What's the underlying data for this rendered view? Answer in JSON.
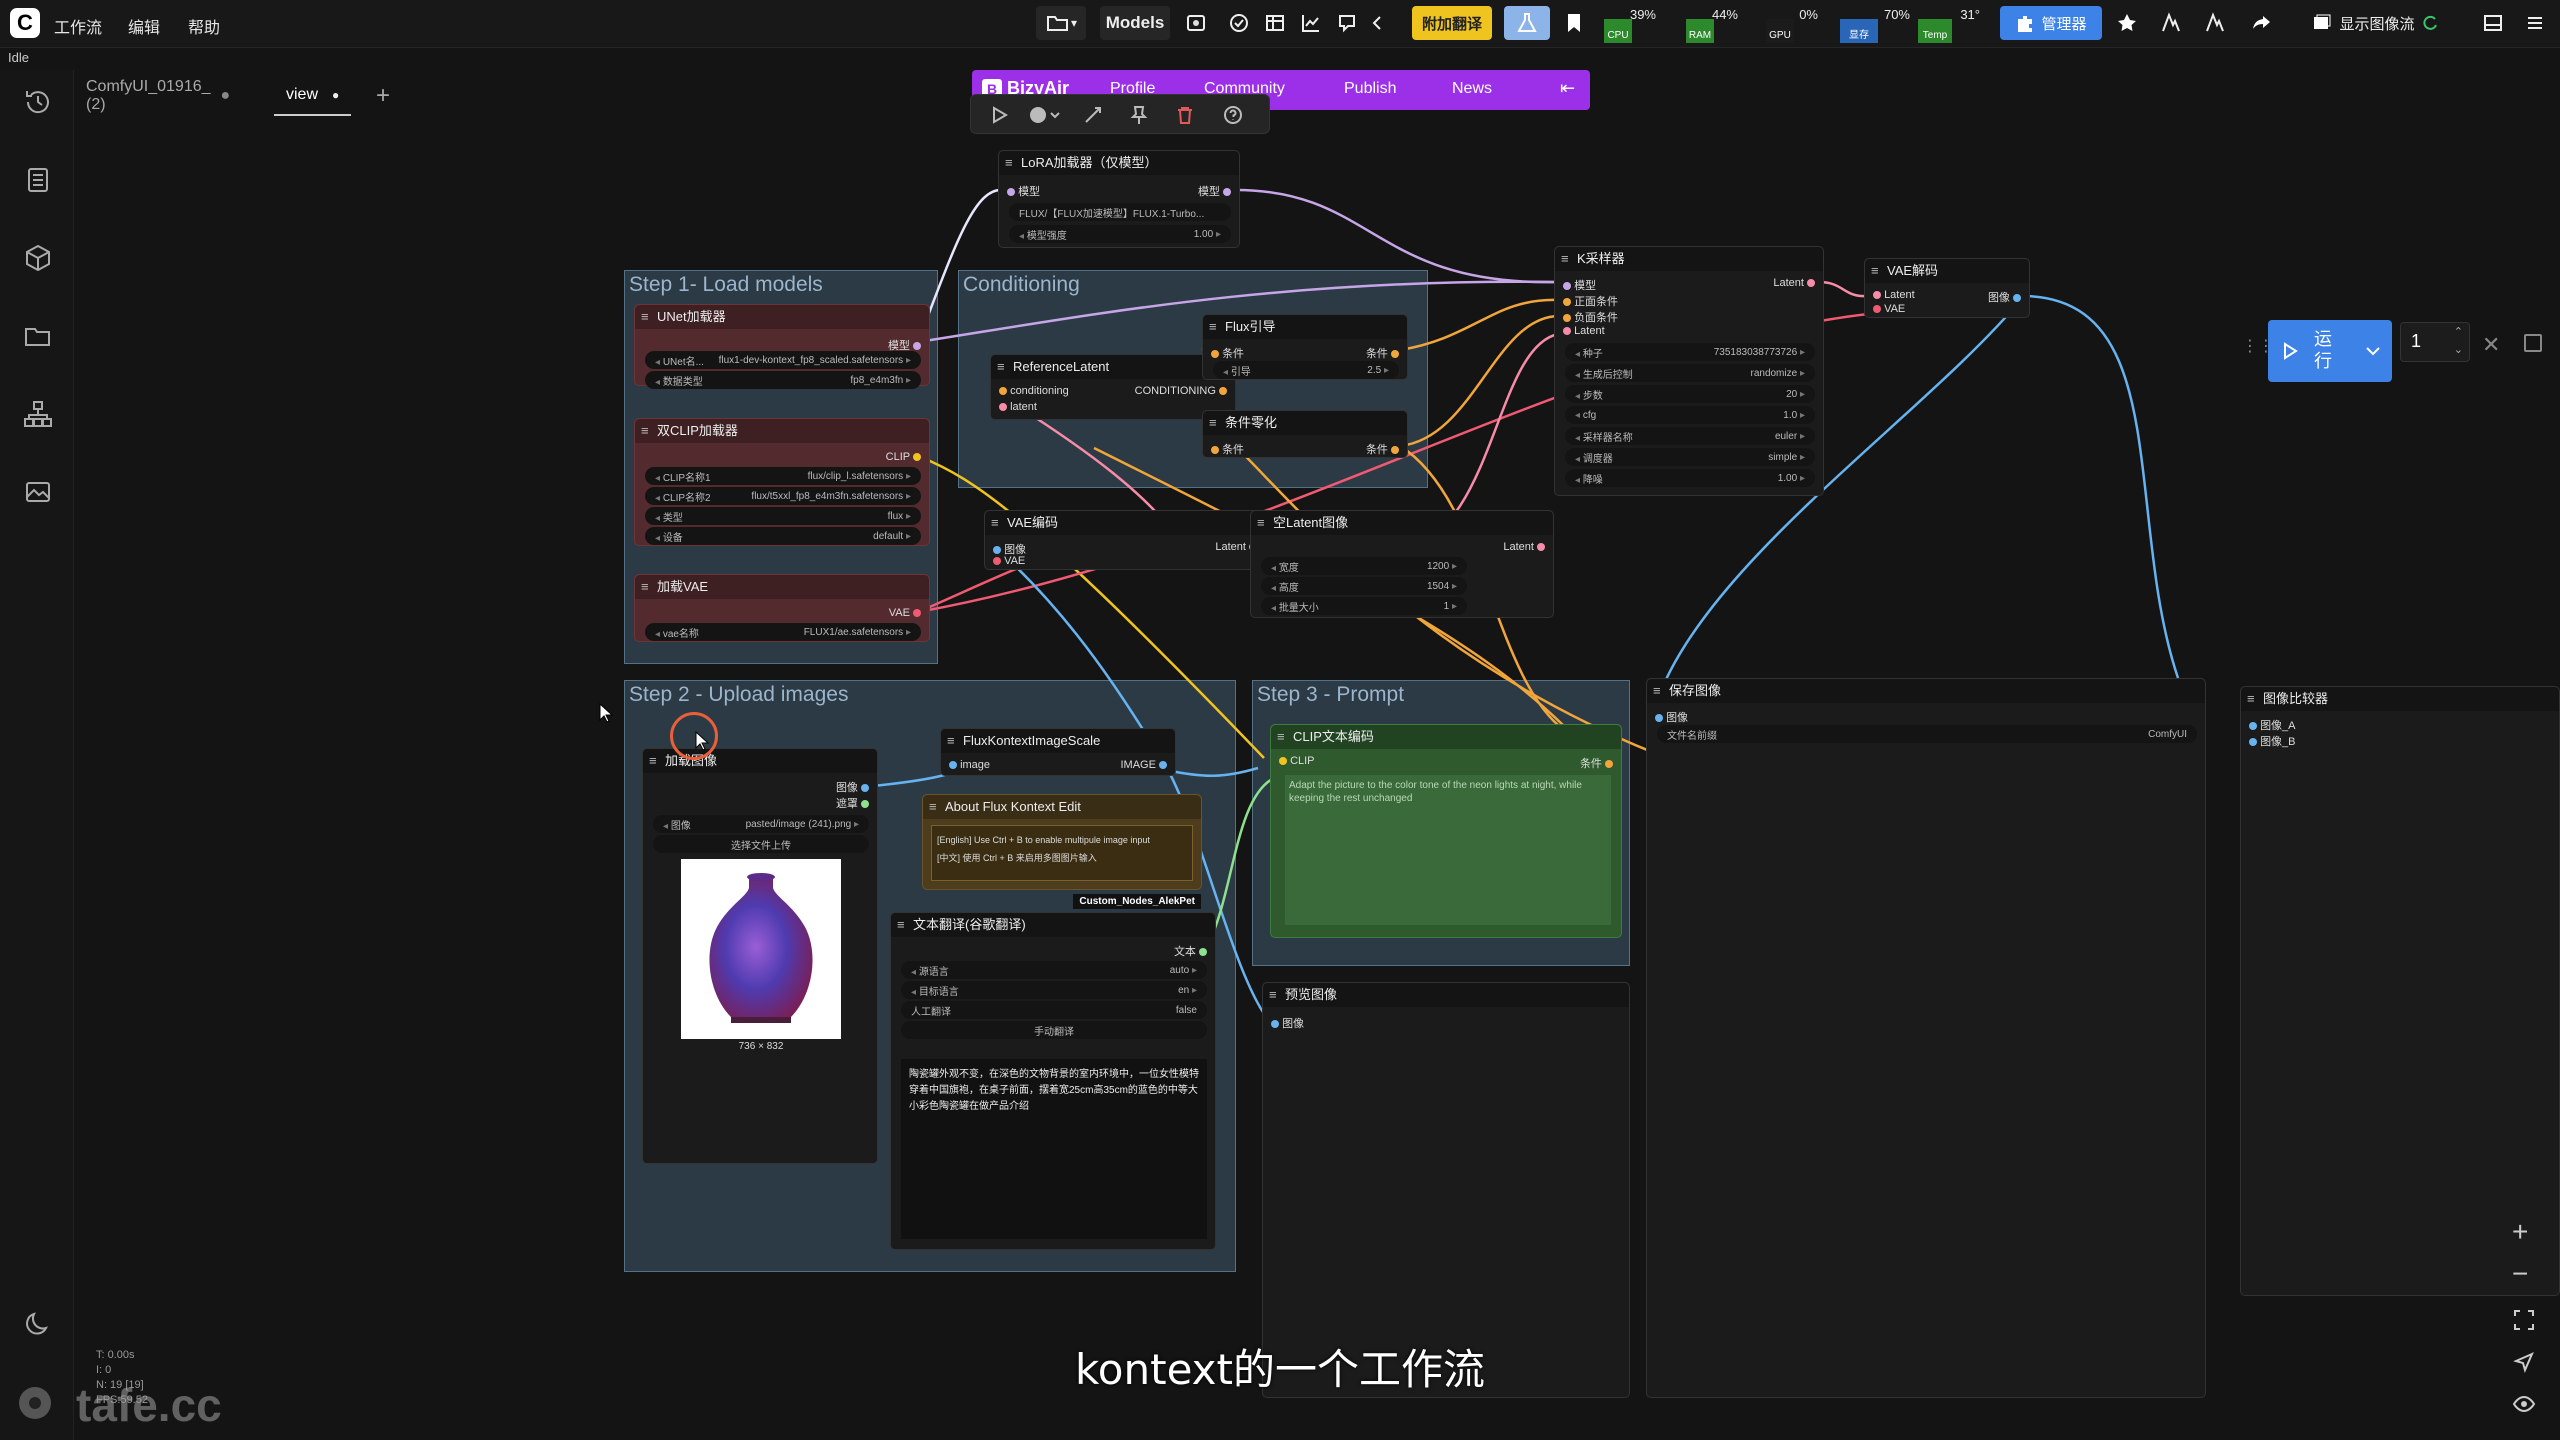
{
  "app": {
    "status": "Idle",
    "menu": [
      "工作流",
      "编辑",
      "帮助"
    ],
    "models_label": "Models",
    "translate_label": "附加翻译",
    "manager_label": "管理器",
    "show_image_flow_label": "显示图像流",
    "logo_letter": "C"
  },
  "resources": [
    {
      "name": "CPU",
      "pct": "39%",
      "color": "#2c8a2c"
    },
    {
      "name": "RAM",
      "pct": "44%",
      "color": "#2c8a2c"
    },
    {
      "name": "GPU",
      "pct": "0%",
      "color": "#1b1b1b"
    },
    {
      "name": "显存",
      "pct": "70%",
      "color": "#2a66b8"
    },
    {
      "name": "Temp",
      "pct": "31°",
      "color": "#2c8a2c"
    }
  ],
  "tabs": [
    {
      "label": "ComfyUI_01916_ (2)"
    },
    {
      "label": "view"
    }
  ],
  "bizyair": {
    "brand": "BizyAir",
    "items": [
      "Profile",
      "Community",
      "Publish",
      "News"
    ]
  },
  "groups": {
    "step1": "Step 1- Load models",
    "conditioning": "Conditioning",
    "step2": "Step 2 - Upload images",
    "step3": "Step 3 - Prompt"
  },
  "nodes": {
    "lora": {
      "title": "LoRA加载器（仅模型）",
      "in": "模型",
      "out": "模型",
      "w1_label": "FLUX/【FLUX加速模型】FLUX.1-Turbo...",
      "w2_label": "模型强度",
      "w2_value": "1.00"
    },
    "unet": {
      "title": "UNet加载器",
      "out": "模型",
      "w1_label": "UNet名...",
      "w1_value": "flux1-dev-kontext_fp8_scaled.safetensors",
      "w2_label": "数据类型",
      "w2_value": "fp8_e4m3fn"
    },
    "clip": {
      "title": "双CLIP加载器",
      "out": "CLIP",
      "w1_label": "CLIP名称1",
      "w1_value": "flux/clip_l.safetensors",
      "w2_label": "CLIP名称2",
      "w2_value": "flux/t5xxl_fp8_e4m3fn.safetensors",
      "w3_label": "类型",
      "w3_value": "flux",
      "w4_label": "设备",
      "w4_value": "default"
    },
    "vae_load": {
      "title": "加载VAE",
      "out": "VAE",
      "w1_label": "vae名称",
      "w1_value": "FLUX1/ae.safetensors"
    },
    "ref_latent": {
      "title": "ReferenceLatent",
      "in1": "conditioning",
      "in2": "latent",
      "out": "CONDITIONING"
    },
    "flux_guide": {
      "title": "Flux引导",
      "in": "条件",
      "out": "条件",
      "w1_label": "引导",
      "w1_value": "2.5"
    },
    "zero_cond": {
      "title": "条件零化",
      "in": "条件",
      "out": "条件"
    },
    "vae_encode": {
      "title": "VAE编码",
      "in1": "图像",
      "in2": "VAE",
      "out": "Latent"
    },
    "empty_latent": {
      "title": "空Latent图像",
      "out": "Latent",
      "w1_label": "宽度",
      "w1_value": "1200",
      "w2_label": "高度",
      "w2_value": "1504",
      "w3_label": "批量大小",
      "w3_value": "1"
    },
    "ksampler": {
      "title": "K采样器",
      "in1": "模型",
      "in2": "正面条件",
      "in3": "负面条件",
      "in4": "Latent",
      "out": "Latent",
      "widgets": [
        {
          "label": "种子",
          "value": "735183038773726"
        },
        {
          "label": "生成后控制",
          "value": "randomize"
        },
        {
          "label": "步数",
          "value": "20"
        },
        {
          "label": "cfg",
          "value": "1.0"
        },
        {
          "label": "采样器名称",
          "value": "euler"
        },
        {
          "label": "调度器",
          "value": "simple"
        },
        {
          "label": "降噪",
          "value": "1.00"
        }
      ]
    },
    "vae_decode": {
      "title": "VAE解码",
      "in1": "Latent",
      "in2": "VAE",
      "out": "图像"
    },
    "load_image": {
      "title": "加载图像",
      "out1": "图像",
      "out2": "遮罩",
      "w1_label": "图像",
      "w1_value": "pasted/image (241).png",
      "upload": "选择文件上传",
      "size": "736 × 832"
    },
    "flux_scale": {
      "title": "FluxKontextImageScale",
      "in": "image",
      "out": "IMAGE"
    },
    "about": {
      "title": "About Flux Kontext Edit",
      "line1": "[English] Use Ctrl + B to enable multipule image input",
      "line2": "[中文] 使用 Ctrl + B 来启用多图图片输入",
      "badge": "Custom_Nodes_AlekPet"
    },
    "translate": {
      "title": "文本翻译(谷歌翻译)",
      "out": "文本",
      "w1_label": "源语言",
      "w1_value": "auto",
      "w2_label": "目标语言",
      "w2_value": "en",
      "w3_label": "人工翻译",
      "w3_value": "false",
      "button": "手动翻译",
      "text": "陶瓷罐外观不变，在深色的文物背景的室内环境中，一位女性模特穿着中国旗袍，在桌子前面，摆着宽25cm高35cm的蓝色的中等大小彩色陶瓷罐在做产品介绍"
    },
    "clip_encode": {
      "title": "CLIP文本编码",
      "in": "CLIP",
      "out": "条件",
      "text": "Adapt the picture to the color tone of the neon lights at night, while keeping the rest unchanged"
    },
    "save_image": {
      "title": "保存图像",
      "in": "图像",
      "w1_label": "文件名前缀",
      "w1_value": "ComfyUI"
    },
    "preview": {
      "title": "预览图像",
      "in": "图像"
    },
    "compare": {
      "title": "图像比较器",
      "in1": "图像_A",
      "in2": "图像_B"
    }
  },
  "run": {
    "label": "运行",
    "count": "1"
  },
  "stats_text": [
    "T: 0.00s",
    "I: 0",
    "N: 19 [19]",
    "FPS:59.52"
  ],
  "watermark": "tafe.cc",
  "subtitle": "kontext的一个工作流"
}
